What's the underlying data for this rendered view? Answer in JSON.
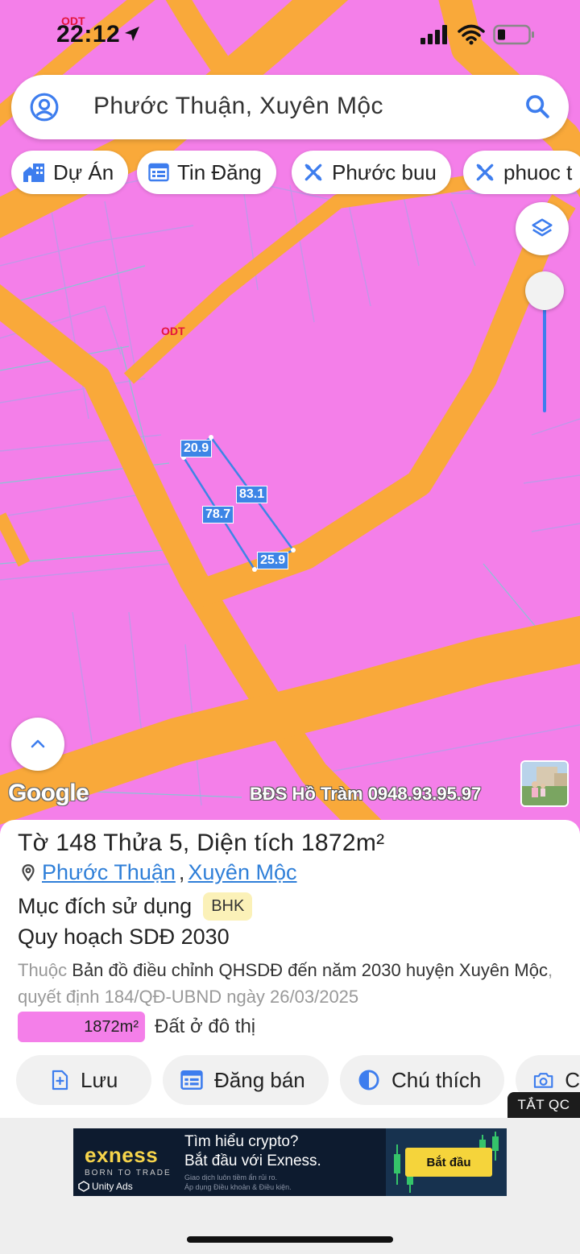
{
  "status": {
    "time": "22:12"
  },
  "search": {
    "query": "Phước Thuận, Xuyên Mộc"
  },
  "chips": [
    {
      "label": "Dự Án",
      "icon": "house-building-icon"
    },
    {
      "label": "Tin Đăng",
      "icon": "calendar-list-icon"
    },
    {
      "label": "Phước buu",
      "icon": "tools-icon"
    },
    {
      "label": "phuoc t",
      "icon": "tools-icon"
    }
  ],
  "map": {
    "zone_labels": [
      "ODT",
      "ODT"
    ],
    "dimensions": {
      "top": "20.9",
      "right": "83.1",
      "left": "78.7",
      "bottom": "25.9"
    },
    "attribution": "Google",
    "watermark": "BĐS Hồ Tràm 0948.93.95.97"
  },
  "parcel": {
    "title_prefix": "Tờ ",
    "sheet": "148",
    "title_mid": " Thửa ",
    "plot": "5",
    "title_area_label": ", Diện tích ",
    "area": "1872",
    "area_unit": "m²",
    "ward": "Phước Thuận",
    "district": "Xuyên Mộc",
    "purpose_label": "Mục đích sử dụng",
    "purpose_code": "BHK",
    "plan_label": "Quy hoạch SDĐ 2030",
    "plan_desc_prefix": "Thuộc ",
    "plan_desc_map": "Bản đồ điều chỉnh QHSDĐ đến năm 2030 huyện Xuyên Mộc",
    "plan_desc_suffix": ", quyết định 184/QĐ-UBND ngày 26/03/2025",
    "landuse_area": "1872m²",
    "landuse_type": "Đất ở đô thị",
    "landuse_color": "#f47fe9"
  },
  "actions": [
    {
      "label": "Lưu",
      "icon": "bookmark-add-icon"
    },
    {
      "label": "Đăng bán",
      "icon": "calendar-list-icon"
    },
    {
      "label": "Chú thích",
      "icon": "half-circle-icon"
    },
    {
      "label": "C",
      "icon": "camera-icon"
    }
  ],
  "ad": {
    "close_label": "TẮT QC",
    "brand": "exness",
    "brand_sub": "BORN TO TRADE",
    "network": "Unity Ads",
    "headline_1": "Tìm hiểu crypto?",
    "headline_2": "Bắt đầu với Exness.",
    "fine_1": "Giao dịch luôn tiềm ẩn rủi ro.",
    "fine_2": "Áp dụng Điều khoản & Điều kiện.",
    "cta": "Bắt đầu"
  },
  "colors": {
    "accent": "#3d7dee",
    "map_zone": "#f47fe9",
    "road": "#f9a93a",
    "link": "#2f7fd8"
  }
}
